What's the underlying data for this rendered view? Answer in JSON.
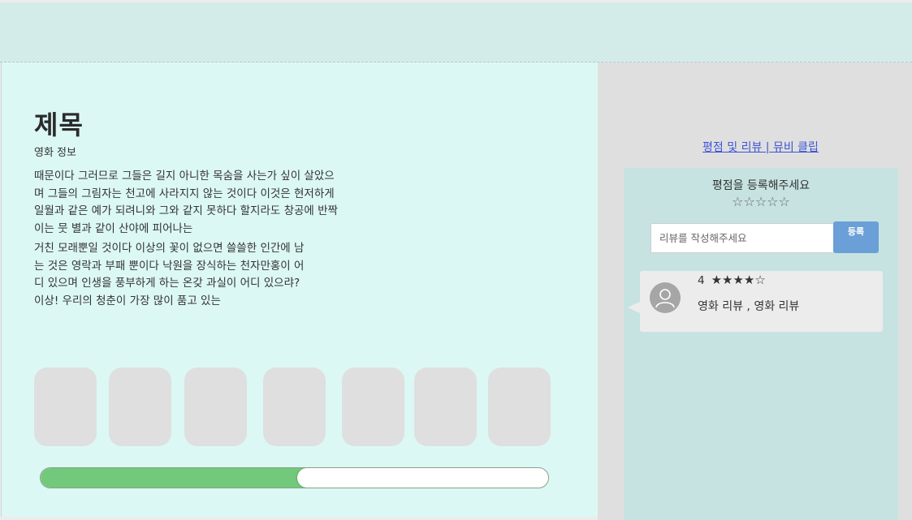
{
  "movie": {
    "title": "제목",
    "info_label": "영화 정보",
    "description_1": "때문이다 그러므로 그들은 길지 아니한 목숨을 사는가 싶이 살았으\n며 그들의 그림자는 천고에 사라지지 않는 것이다 이것은 현저하게\n일월과 같은 예가 되려니와 그와 같지 못하다 할지라도 창공에 반짝\n이는 뭇 별과 같이 산야에 피어나는",
    "description_2": "거친 모래뿐일 것이다 이상의 꽃이 없으면 쓸쓸한 인간에 남\n는 것은 영락과 부패 뿐이다 낙원을 장식하는 천자만홍이 어\n디 있으며 인생을 풍부하게 하는 온갖 과실이 어디 있으랴?\n이상! 우리의 청춘이 가장 많이 품고 있는"
  },
  "progress": {
    "value_fraction": 0.505
  },
  "sidebar": {
    "links_text": "평점 및 리뷰 | 뮤비 클립",
    "rating_prompt": "평점을 등록해주세요",
    "empty_stars": "☆☆☆☆☆",
    "review_placeholder": "리뷰를 작성해주세요",
    "submit_label": "등록"
  },
  "reviews": [
    {
      "rating": "4",
      "stars": "★★★★☆",
      "text": "영화 리뷰 , 영화 리뷰",
      "icon": "user-avatar-icon"
    }
  ],
  "colors": {
    "header_bg": "#d3ecea",
    "main_bg": "#dcf8f5",
    "panel_bg": "#c6e3e1",
    "progress_fill": "#72c97c",
    "button": "#6a9fd8",
    "link": "#3d54d6"
  }
}
